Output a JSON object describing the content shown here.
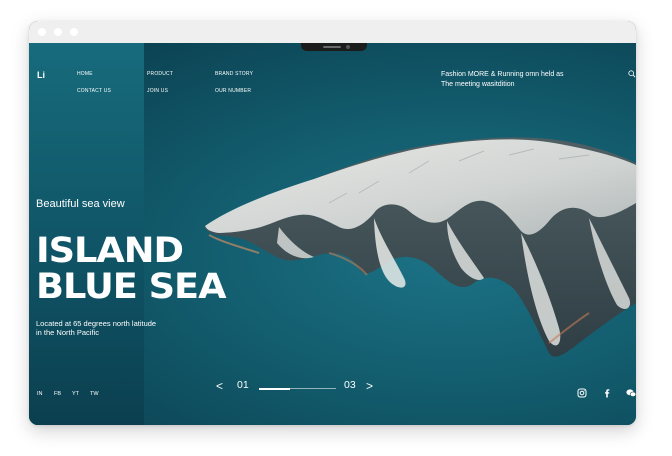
{
  "brand": {
    "logo": "Li"
  },
  "nav": {
    "home": "HOME",
    "product": "PRODUCT",
    "brand_story": "BRAND STORY",
    "contact_us": "CONTACT US",
    "join_us": "JOIN US",
    "our_number": "OUR NUMBER"
  },
  "headline": {
    "line1": "Fashion MORE & Running omn held as",
    "line2": "The meeting wasitdition"
  },
  "hero": {
    "subtitle": "Beautiful sea view",
    "title_line1": "ISLAND",
    "title_line2": "BLUE SEA",
    "desc_line1": "Located at 65 degrees north latitude",
    "desc_line2": "in the North Pacific"
  },
  "social_text": [
    "IN",
    "FB",
    "YT",
    "TW"
  ],
  "pager": {
    "prev": "<",
    "current": "01",
    "total": "03",
    "next": ">",
    "progress": 0.4
  },
  "icons": {
    "search": "search-icon",
    "instagram": "instagram-icon",
    "facebook": "facebook-icon",
    "wechat": "wechat-icon"
  },
  "colors": {
    "sea_dark": "#0b3f4f",
    "sea_mid": "#11596a",
    "panel": "#176b7c",
    "text": "#ffffff"
  }
}
